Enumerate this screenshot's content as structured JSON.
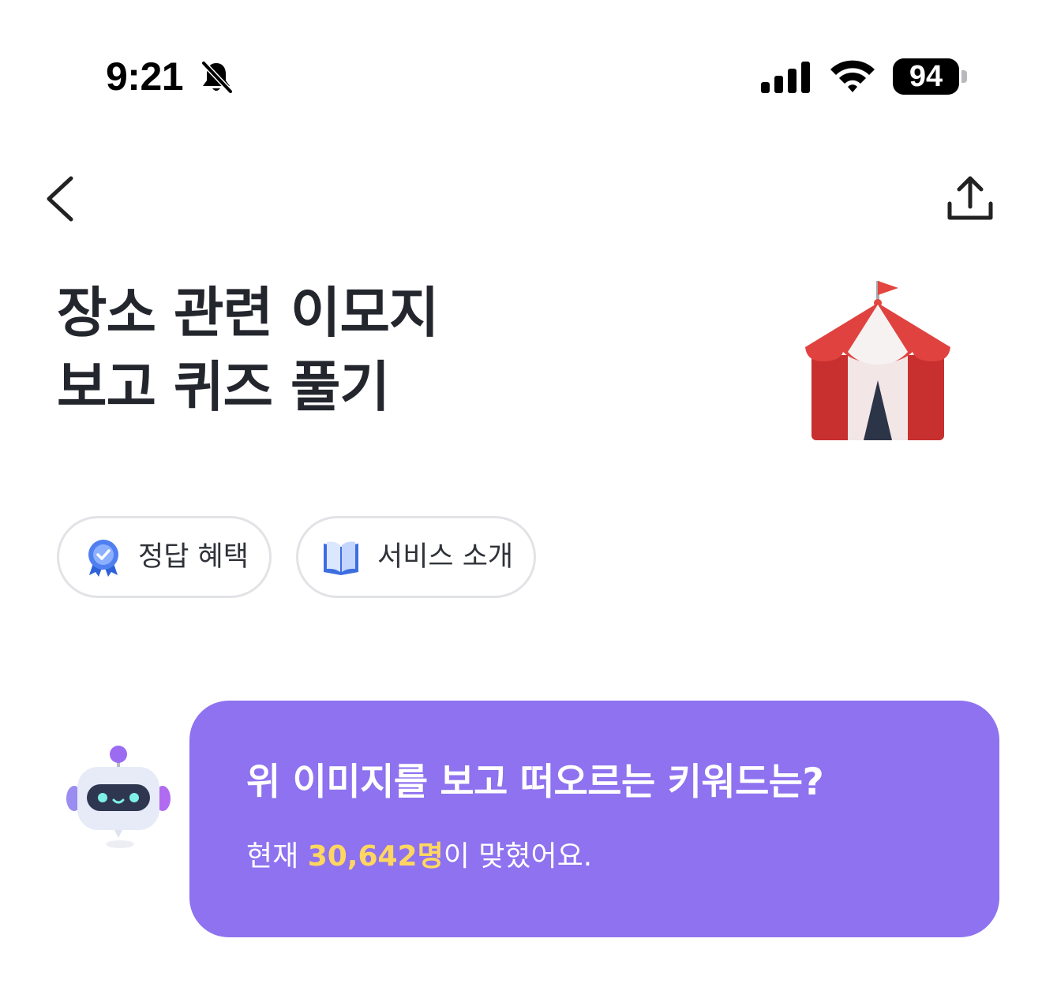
{
  "status_bar": {
    "time": "9:21",
    "battery": "94",
    "icons": [
      "bell-slash-icon",
      "cellular-signal-icon",
      "wifi-icon",
      "battery-icon"
    ]
  },
  "nav": {
    "back_icon": "chevron-left-icon",
    "share_icon": "share-upload-icon"
  },
  "title": {
    "line1": "장소 관련 이모지",
    "line2": "보고 퀴즈 풀기",
    "emoji_icon": "circus-tent-icon"
  },
  "chips": [
    {
      "label": "정답 혜택",
      "icon": "award-badge-icon"
    },
    {
      "label": "서비스 소개",
      "icon": "open-book-icon"
    }
  ],
  "quiz": {
    "avatar_icon": "robot-icon",
    "question": "위 이미지를 보고 떠오르는 키워드는?",
    "stat_prefix": "현재 ",
    "stat_count": "30,642명",
    "stat_suffix": "이 맞혔어요.",
    "colors": {
      "card": "#8e72ef",
      "count_highlight": "#ffd760"
    }
  }
}
